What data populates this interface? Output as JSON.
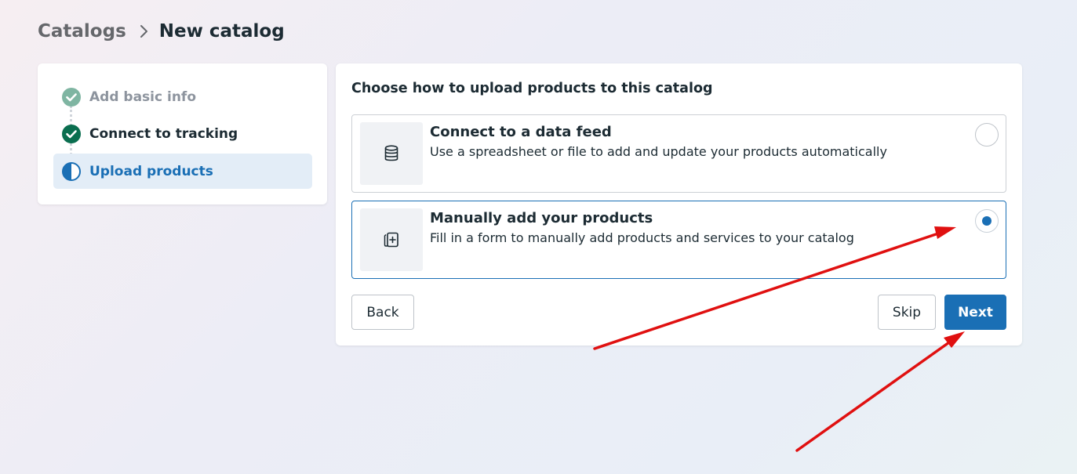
{
  "breadcrumb": {
    "parent": "Catalogs",
    "current": "New catalog"
  },
  "steps": [
    {
      "label": "Add basic info",
      "state": "completed",
      "icon": "check-circle-icon"
    },
    {
      "label": "Connect to tracking",
      "state": "completed",
      "icon": "check-circle-icon"
    },
    {
      "label": "Upload products",
      "state": "current",
      "icon": "half-circle-icon"
    }
  ],
  "main": {
    "title": "Choose how to upload products to this catalog",
    "options": [
      {
        "title": "Connect to a data feed",
        "description": "Use a spreadsheet or file to add and update your products automatically",
        "icon": "database-icon",
        "selected": false
      },
      {
        "title": "Manually add your products",
        "description": "Fill in a form to manually add products and services to your catalog",
        "icon": "add-card-icon",
        "selected": true
      }
    ],
    "buttons": {
      "back": "Back",
      "skip": "Skip",
      "next": "Next"
    }
  },
  "colors": {
    "accent": "#1a6fb5",
    "success": "#0a6e4f",
    "annotation": "#e01010"
  }
}
